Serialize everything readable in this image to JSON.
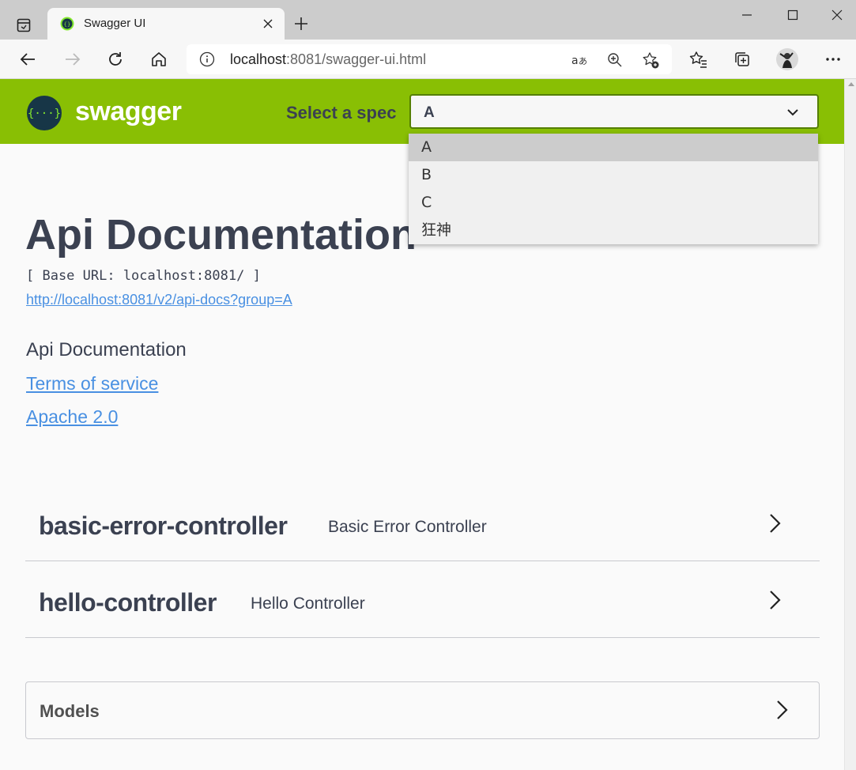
{
  "browser": {
    "tab_title": "Swagger UI",
    "url_host": "localhost",
    "url_rest": ":8081/swagger-ui.html"
  },
  "topbar": {
    "logo_text": "swagger",
    "logo_symbol": "{···}",
    "spec_label": "Select a spec",
    "selected_spec": "A",
    "spec_options": [
      "A",
      "B",
      "C",
      "狂神"
    ],
    "brand_color": "#89bf04"
  },
  "info": {
    "title": "Api Documentation",
    "base_url": "[ Base URL: localhost:8081/ ]",
    "spec_link": "http://localhost:8081/v2/api-docs?group=A",
    "description": "Api Documentation",
    "terms_link": "Terms of service",
    "license_link": "Apache 2.0"
  },
  "tags": [
    {
      "name": "basic-error-controller",
      "description": "Basic Error Controller"
    },
    {
      "name": "hello-controller",
      "description": "Hello Controller"
    }
  ],
  "models": {
    "title": "Models"
  }
}
